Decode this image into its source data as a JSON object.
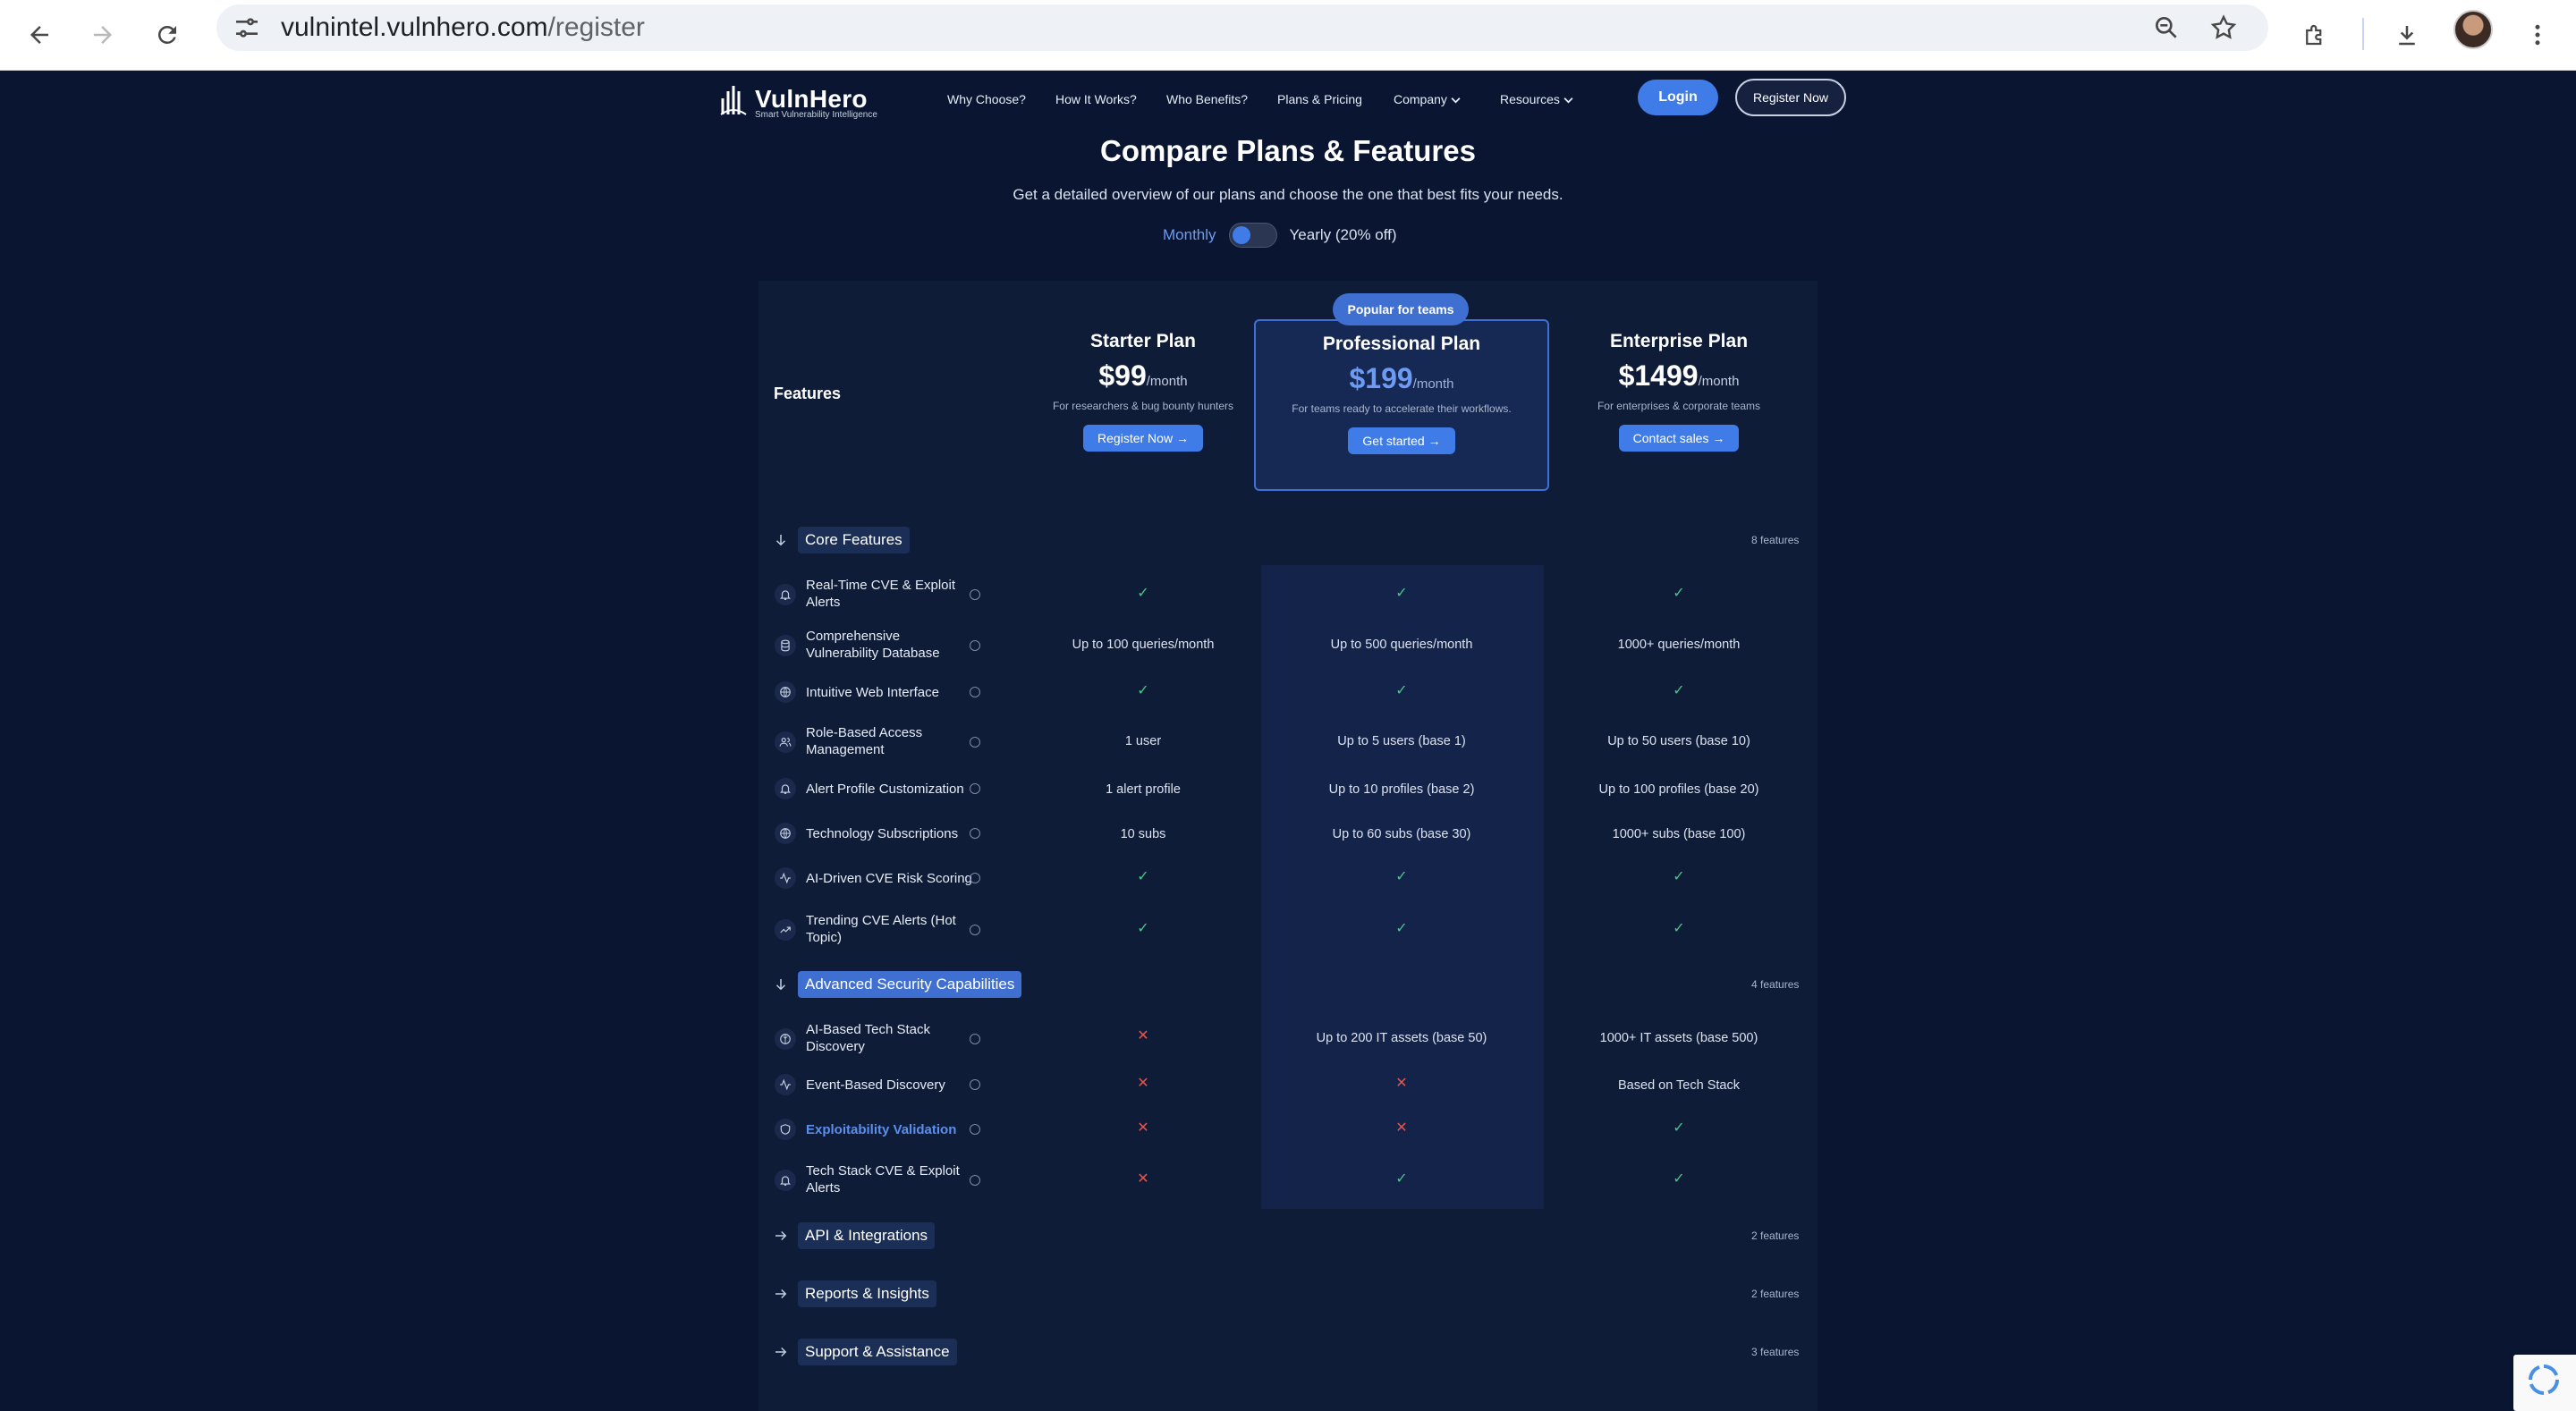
{
  "browser": {
    "url_host": "vulnintel.vulnhero.com",
    "url_path": "/register"
  },
  "site": {
    "logo_name": "VulnHero",
    "logo_tagline": "Smart Vulnerability Intelligence",
    "nav": [
      "Why Choose?",
      "How It Works?",
      "Who Benefits?",
      "Plans & Pricing",
      "Company",
      "Resources"
    ],
    "login_label": "Login",
    "register_label": "Register Now"
  },
  "hero": {
    "title": "Compare Plans & Features",
    "subtitle": "Get a detailed overview of our plans and choose the one that best fits your needs.",
    "monthly_label": "Monthly",
    "yearly_label": "Yearly (20% off)"
  },
  "table": {
    "features_heading": "Features",
    "plans": [
      {
        "name": "Starter Plan",
        "price": "$99",
        "per": "/month",
        "desc": "For researchers & bug bounty hunters",
        "cta": "Register Now →"
      },
      {
        "name": "Professional Plan",
        "price": "$199",
        "per": "/month",
        "desc": "For teams ready to accelerate their workflows.",
        "cta": "Get started →",
        "badge": "Popular for teams"
      },
      {
        "name": "Enterprise Plan",
        "price": "$1499",
        "per": "/month",
        "desc": "For enterprises & corporate teams",
        "cta": "Contact sales →"
      }
    ],
    "sections": [
      {
        "label": "Core Features",
        "count": "8 features"
      },
      {
        "label": "Advanced Security Capabilities",
        "count": "4 features"
      },
      {
        "label": "API & Integrations",
        "count": "2 features"
      },
      {
        "label": "Reports & Insights",
        "count": "2 features"
      },
      {
        "label": "Support & Assistance",
        "count": "3 features"
      }
    ],
    "core_rows": [
      {
        "name": "Real-Time CVE & Exploit Alerts",
        "icon": "bell-icon",
        "starter": "✓",
        "pro": "✓",
        "enterprise": "✓"
      },
      {
        "name": "Comprehensive Vulnerability Database",
        "icon": "database-icon",
        "starter": "Up to 100 queries/month",
        "pro": "Up to 500 queries/month",
        "enterprise": "1000+ queries/month"
      },
      {
        "name": "Intuitive Web Interface",
        "icon": "globe-icon",
        "starter": "✓",
        "pro": "✓",
        "enterprise": "✓"
      },
      {
        "name": "Role-Based Access Management",
        "icon": "users-icon",
        "starter": "1 user",
        "pro": "Up to 5 users (base 1)",
        "enterprise": "Up to 50 users (base 10)"
      },
      {
        "name": "Alert Profile Customization",
        "icon": "bell-icon",
        "starter": "1 alert profile",
        "pro": "Up to 10 profiles (base 2)",
        "enterprise": "Up to 100 profiles (base 20)"
      },
      {
        "name": "Technology Subscriptions",
        "icon": "globe-icon",
        "starter": "10 subs",
        "pro": "Up to 60 subs (base 30)",
        "enterprise": "1000+ subs (base 100)"
      },
      {
        "name": "AI-Driven CVE Risk Scoring",
        "icon": "activity-icon",
        "starter": "✓",
        "pro": "✓",
        "enterprise": "✓"
      },
      {
        "name": "Trending CVE Alerts (Hot Topic)",
        "icon": "trending-icon",
        "starter": "✓",
        "pro": "✓",
        "enterprise": "✓"
      }
    ],
    "advanced_rows": [
      {
        "name": "AI-Based Tech Stack Discovery",
        "icon": "brain-icon",
        "starter": "✕",
        "pro": "Up to 200 IT assets (base 50)",
        "enterprise": "1000+ IT assets (base 500)"
      },
      {
        "name": "Event-Based Discovery",
        "icon": "activity-icon",
        "starter": "✕",
        "pro": "✕",
        "enterprise": "Based on Tech Stack"
      },
      {
        "name": "Exploitability Validation",
        "icon": "shield-icon",
        "starter": "✕",
        "pro": "✕",
        "enterprise": "✓"
      },
      {
        "name": "Tech Stack CVE & Exploit Alerts",
        "icon": "bell-icon",
        "starter": "✕",
        "pro": "✓",
        "enterprise": "✓"
      }
    ]
  }
}
